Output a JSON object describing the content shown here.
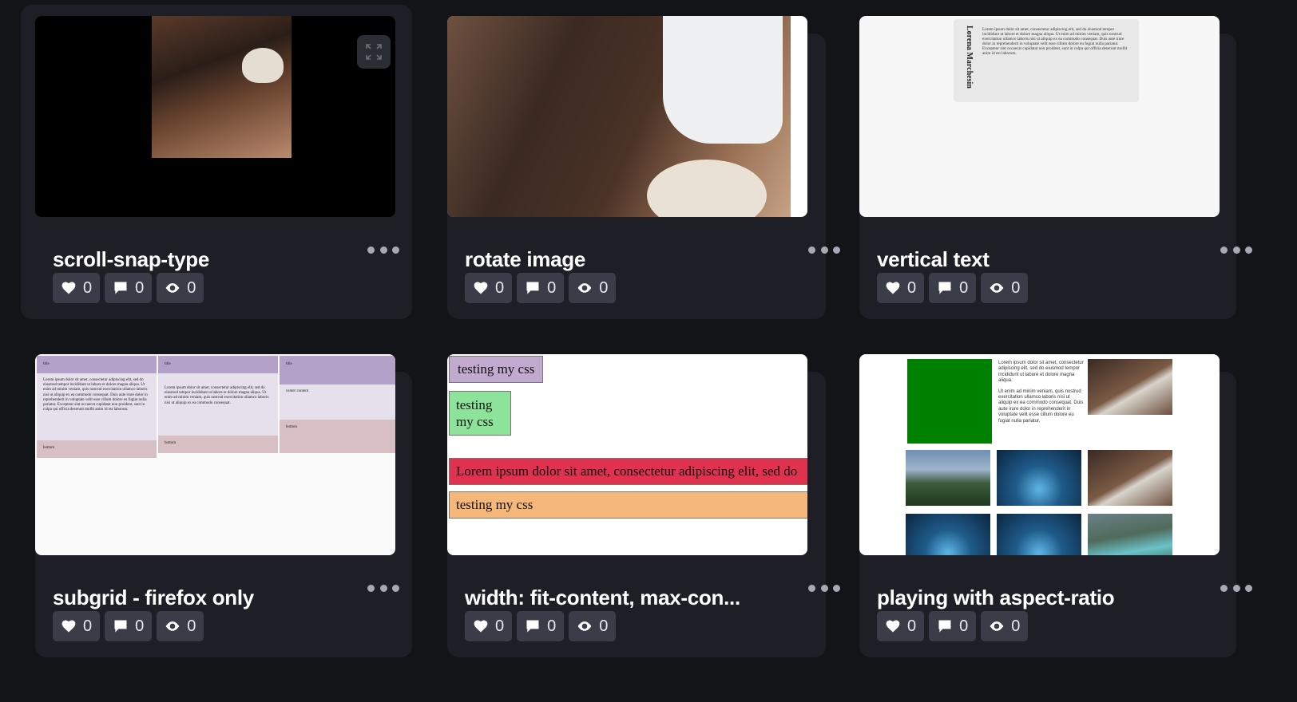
{
  "cards": [
    {
      "title": "scroll-snap-type",
      "likes": "0",
      "comments": "0",
      "views": "0"
    },
    {
      "title": "rotate image",
      "likes": "0",
      "comments": "0",
      "views": "0"
    },
    {
      "title": "vertical text",
      "likes": "0",
      "comments": "0",
      "views": "0"
    },
    {
      "title": "subgrid - firefox only",
      "likes": "0",
      "comments": "0",
      "views": "0"
    },
    {
      "title": "width: fit-content, max-con...",
      "likes": "0",
      "comments": "0",
      "views": "0"
    },
    {
      "title": "playing with aspect-ratio",
      "likes": "0",
      "comments": "0",
      "views": "0"
    }
  ],
  "previews": {
    "vertical_text": {
      "name": "Lorena Marchesin",
      "body": "Lorem ipsum dolor sit amet, consectetur adipiscing elit, sed do eiusmod tempor incididunt ut labore et dolore magna aliqua. Ut enim ad minim veniam, quis nostrud exercitation ullamco laboris nisi ut aliquip ex ea commodo consequat. Duis aute irure dolor in reprehenderit in voluptate velit esse cillum dolore eu fugiat nulla pariatur. Excepteur sint occaecat cupidatat non proident, sunt in culpa qui officia deserunt mollit anim id est laborum."
    },
    "subgrid": {
      "col1": {
        "title": "title",
        "content": "Lorem ipsum dolor sit amet, consectetur adipiscing elit, sed do eiusmod tempor incididunt ut labore et dolore magna aliqua. Ut enim ad minim veniam, quis nostrud exercitation ullamco laboris nisi ut aliquip ex ea commodo consequat. Duis aute irure dolor in reprehenderit in voluptate velit esse cillum dolore eu fugiat nulla pariatur. Excepteur sint occaecat cupidatat non proident, sunt in culpa qui officia deserunt mollit anim id est laborum.",
        "bottom": "bottom"
      },
      "col2": {
        "title": "title",
        "content": "Lorem ipsum dolor sit amet, consectetur adipiscing elit, sed do eiusmod tempor incididunt ut labore et dolore magna aliqua. Ut enim ad minim veniam, quis nostrud exercitation ullamco laboris nisi ut aliquip ex ea commodo consequat.",
        "bottom": "bottom"
      },
      "col3": {
        "title": "title",
        "content": "center content",
        "bottom": "bottom"
      }
    },
    "fit_content": {
      "box1": "testing my css",
      "box2": "testing my css",
      "box3": "Lorem ipsum dolor sit amet, consectetur adipiscing elit, sed do",
      "box4": "testing my css"
    },
    "aspect_ratio": {
      "p1": "Lorem ipsum dolor sit amet, consectetur adipiscing elit, sed do eiusmod tempor incididunt ut labore et dolore magna aliqua.",
      "p2": "Ut enim ad minim veniam, quis nostrud exercitation ullamco laboris nisi ut aliquip ex ea commodo consequat. Duis aute irure dolor in reprehenderit in voluptate velit esse cillum dolore eu fugiat nulla pariatur."
    }
  }
}
